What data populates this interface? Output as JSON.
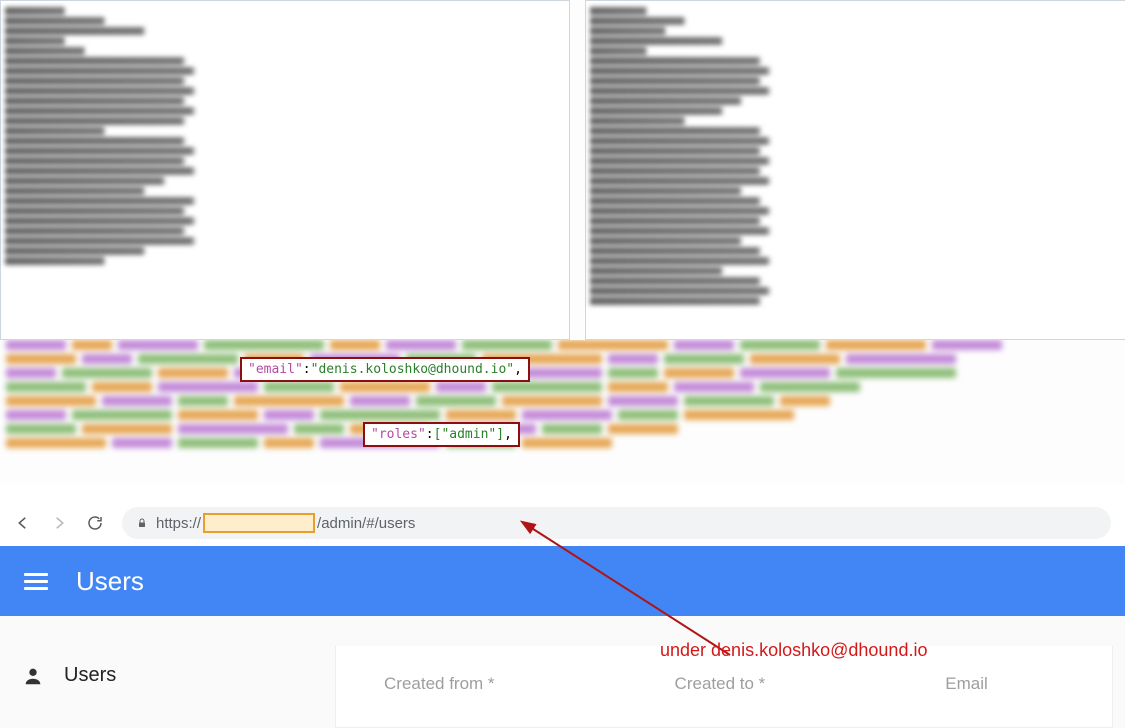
{
  "code_highlight": {
    "email_key": "\"email\"",
    "email_val": "\"denis.koloshko@dhound.io\"",
    "roles_key": "\"roles\"",
    "roles_val": "[\"admin\"]"
  },
  "browser": {
    "scheme": "https://",
    "path": "/admin/#/users"
  },
  "app": {
    "header_title": "Users",
    "section_label": "Users"
  },
  "filters": {
    "created_from": "Created from *",
    "created_to": "Created to *",
    "email": "Email"
  },
  "annotation": {
    "text": "under denis.koloshko@dhound.io"
  }
}
